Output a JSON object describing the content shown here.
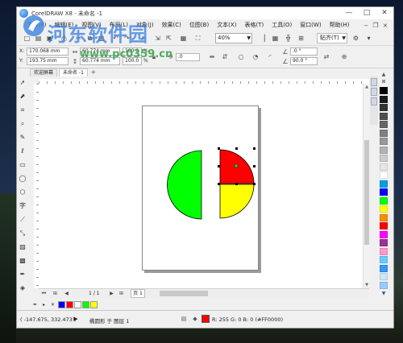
{
  "app": {
    "title": "CorelDRAW X8 - 未命名 -1",
    "window_controls": [
      "—",
      "□",
      "✕"
    ]
  },
  "menubar": {
    "items": [
      "文件(F)",
      "编辑(E)",
      "视图(V)",
      "布局(L)",
      "对象(J)",
      "效果(C)",
      "位图(B)",
      "文本(X)",
      "表格(T)",
      "工具(O)",
      "窗口(W)",
      "帮助(H)"
    ]
  },
  "toolbar": {
    "zoom_value": "40%",
    "snap_label": "贴齐(T)"
  },
  "propbar": {
    "x_label": "X:",
    "x_value": "170.068 mm",
    "y_label": "Y:",
    "y_value": "193.75 mm",
    "w_value": "60.774 mm",
    "h_value": "60.774 mm",
    "scale_x": "100.0",
    "scale_y": "100.0",
    "percent": "%",
    "rotation": ".0",
    "start_angle": ".0 °",
    "end_angle": "90.0 °"
  },
  "tabs": {
    "welcome": "欢迎屏幕",
    "document": "未命名 -1",
    "add": "+"
  },
  "pagebar": {
    "page_count": "1 / 1",
    "page_tab": "页 1"
  },
  "palette": {
    "colors": [
      "#000000",
      "#1a1a1a",
      "#333333",
      "#4d4d4d",
      "#666666",
      "#808080",
      "#999999",
      "#b3b3b3",
      "#cccccc",
      "#e6e6e6",
      "#ffffff",
      "#00a0e9",
      "#0000ff",
      "#00ff00",
      "#ffff00",
      "#ff8c00",
      "#ff0000",
      "#ff00ff",
      "#993399",
      "#ff99cc",
      "#66ccff",
      "#3399ff",
      "#cce6ff",
      "#99ccff"
    ]
  },
  "document_palette": {
    "colors": [
      "#0000ff",
      "#ff0000",
      "#ffffff",
      "#00ff00",
      "#ffff00"
    ]
  },
  "status": {
    "coords": "( -147.675, 332.473 )",
    "object_info": "椭圆形 于 图层 1",
    "fill_info": "R: 255 G: 0 B: 0 (#FF0000)",
    "fill_color": "#FF0000"
  },
  "watermark": {
    "title": "河东软件园",
    "url": "www.pc0359.cn"
  },
  "artwork": {
    "left_half_color": "#00ff00",
    "quarter_top_color": "#ff0000",
    "quarter_bottom_color": "#ffff00",
    "selection_node_color": "#000000"
  }
}
